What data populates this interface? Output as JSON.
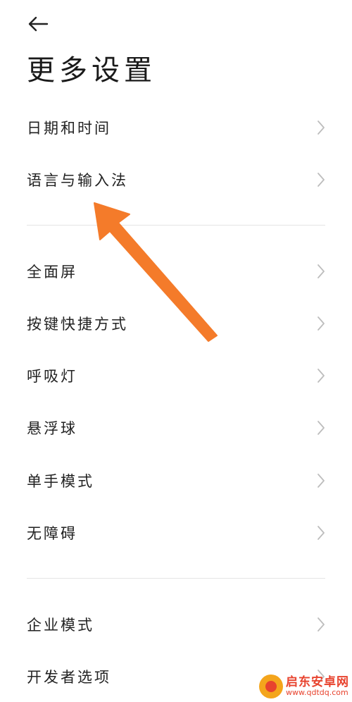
{
  "header": {
    "back_icon": "arrow-left-icon",
    "title": "更多设置"
  },
  "groups": [
    {
      "items": [
        {
          "label": "日期和时间"
        },
        {
          "label": "语言与输入法"
        }
      ]
    },
    {
      "items": [
        {
          "label": "全面屏"
        },
        {
          "label": "按键快捷方式"
        },
        {
          "label": "呼吸灯"
        },
        {
          "label": "悬浮球"
        },
        {
          "label": "单手模式"
        },
        {
          "label": "无障碍"
        }
      ]
    },
    {
      "items": [
        {
          "label": "企业模式"
        },
        {
          "label": "开发者选项"
        }
      ]
    }
  ],
  "annotation": {
    "icon": "orange-arrow-pointer-icon",
    "color": "#f47b2a"
  },
  "watermark": {
    "name": "启东安卓网",
    "url": "www.qdtdq.com"
  },
  "colors": {
    "text": "#222222",
    "chevron": "#bdbdbd",
    "divider": "#e4e4e4"
  }
}
